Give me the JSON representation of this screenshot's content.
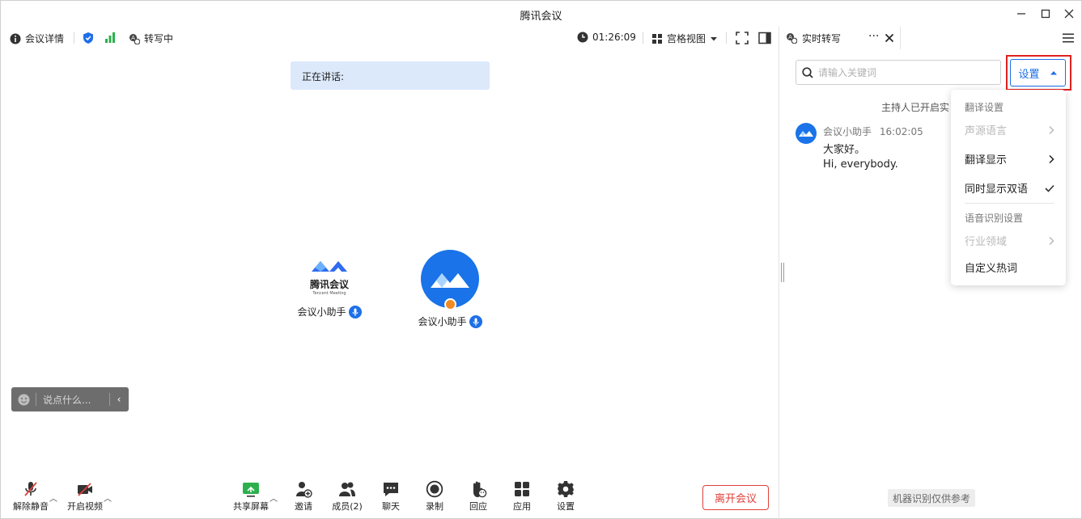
{
  "window": {
    "title": "腾讯会议"
  },
  "top_toolbar": {
    "meeting_info": "会议详情",
    "transcribing": "转写中",
    "timer": "01:26:09",
    "view_mode": "宫格视图"
  },
  "stage": {
    "speaking_label": "正在讲话:",
    "tiles": [
      {
        "name": "会议小助手",
        "logo_text": "腾讯会议",
        "logo_subtext": "Tencent Meeting"
      },
      {
        "name": "会议小助手"
      }
    ],
    "chat_placeholder": "说点什么..."
  },
  "bottom_toolbar": {
    "unmute": "解除静音",
    "start_video": "开启视频",
    "share_screen": "共享屏幕",
    "invite": "邀请",
    "members": "成员(2)",
    "chat": "聊天",
    "record": "录制",
    "react": "回应",
    "apps": "应用",
    "settings": "设置",
    "leave": "离开会议"
  },
  "transcript_panel": {
    "tab_label": "实时转写",
    "search_placeholder": "请输入关键词",
    "settings_button": "设置",
    "system_message": "主持人已开启实",
    "messages": [
      {
        "speaker": "会议小助手",
        "time": "16:02:05",
        "original": "大家好。",
        "translation": "Hi, everybody."
      }
    ],
    "disclaimer": "机器识别仅供参考"
  },
  "settings_menu": {
    "translate_header": "翻译设置",
    "items": [
      {
        "label": "声源语言",
        "disabled": true,
        "arrow": true
      },
      {
        "label": "翻译显示",
        "disabled": false,
        "arrow": true
      },
      {
        "label": "同时显示双语",
        "disabled": false,
        "checked": true
      }
    ],
    "speech_header": "语音识别设置",
    "speech_items": [
      {
        "label": "行业领域",
        "disabled": true,
        "arrow": true
      },
      {
        "label": "自定义热词",
        "disabled": false
      }
    ]
  },
  "colors": {
    "accent": "#1e6fe8",
    "danger": "#e0403a",
    "highlight": "#e02020",
    "speaking_bg": "#dce9fb"
  }
}
